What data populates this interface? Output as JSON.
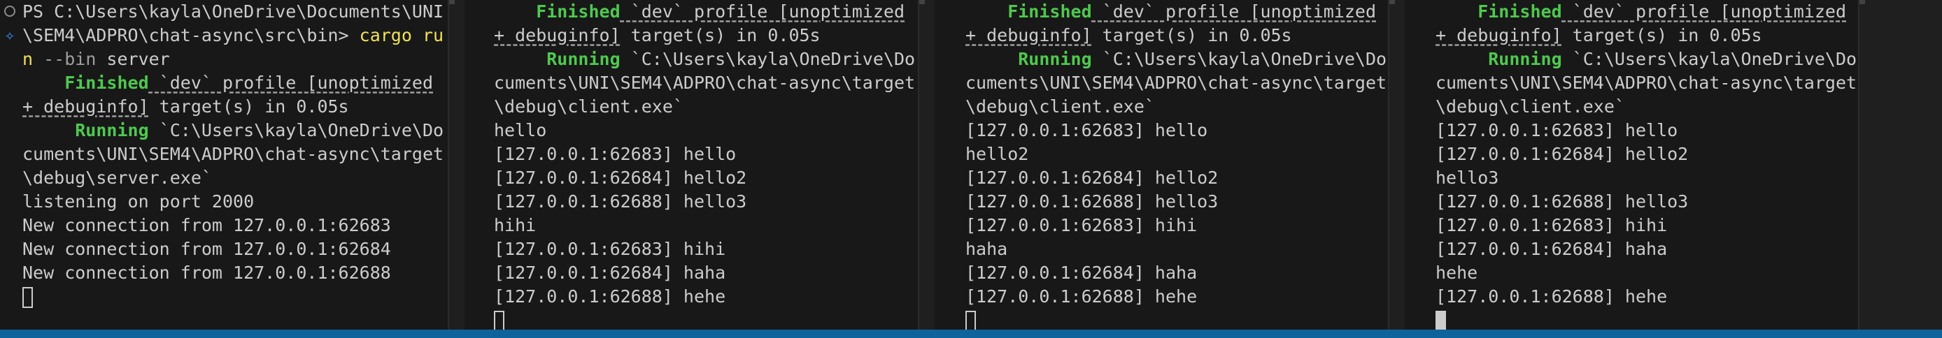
{
  "panes": [
    {
      "lines": [
        {
          "segments": [
            {
              "t": "PS C:\\Users\\kayla\\OneDrive\\Documents\\UNI",
              "c": "muted"
            }
          ]
        },
        {
          "segments": [
            {
              "t": "\\SEM4\\ADPRO\\chat-async\\src\\bin> ",
              "c": "muted"
            },
            {
              "t": "cargo ru",
              "c": "yellow"
            }
          ]
        },
        {
          "segments": [
            {
              "t": "n ",
              "c": "yellow"
            },
            {
              "t": "--bin",
              "c": "dim"
            },
            {
              "t": " server",
              "c": "muted"
            }
          ]
        },
        {
          "segments": [
            {
              "t": "    Finished",
              "c": "green"
            },
            {
              "t": " `dev` profile [unoptimized",
              "c": "ul"
            }
          ]
        },
        {
          "segments": [
            {
              "t": "+ debuginfo]",
              "c": "ul"
            },
            {
              "t": " target(s) in 0.05s",
              "c": "muted"
            }
          ]
        },
        {
          "segments": [
            {
              "t": "     Running",
              "c": "green"
            },
            {
              "t": " `C:\\Users\\kayla\\OneDrive\\Do",
              "c": "muted"
            }
          ]
        },
        {
          "segments": [
            {
              "t": "cuments\\UNI\\SEM4\\ADPRO\\chat-async\\target",
              "c": "muted"
            }
          ]
        },
        {
          "segments": [
            {
              "t": "\\debug\\server.exe`",
              "c": "muted"
            }
          ]
        },
        {
          "segments": [
            {
              "t": "listening on port 2000",
              "c": "muted"
            }
          ]
        },
        {
          "segments": [
            {
              "t": "New connection from 127.0.0.1:62683",
              "c": "muted"
            }
          ]
        },
        {
          "segments": [
            {
              "t": "New connection from 127.0.0.1:62684",
              "c": "muted"
            }
          ]
        },
        {
          "segments": [
            {
              "t": "New connection from 127.0.0.1:62688",
              "c": "muted"
            }
          ]
        }
      ],
      "cursor": "outline"
    },
    {
      "lines": [
        {
          "segments": [
            {
              "t": "    Finished",
              "c": "green"
            },
            {
              "t": " `dev` profile [unoptimized",
              "c": "ul"
            }
          ]
        },
        {
          "segments": [
            {
              "t": "+ debuginfo]",
              "c": "ul"
            },
            {
              "t": " target(s) in 0.05s",
              "c": "muted"
            }
          ]
        },
        {
          "segments": [
            {
              "t": "     Running",
              "c": "green"
            },
            {
              "t": " `C:\\Users\\kayla\\OneDrive\\Do",
              "c": "muted"
            }
          ]
        },
        {
          "segments": [
            {
              "t": "cuments\\UNI\\SEM4\\ADPRO\\chat-async\\target",
              "c": "muted"
            }
          ]
        },
        {
          "segments": [
            {
              "t": "\\debug\\client.exe`",
              "c": "muted"
            }
          ]
        },
        {
          "segments": [
            {
              "t": "hello",
              "c": "muted"
            }
          ]
        },
        {
          "segments": [
            {
              "t": "[127.0.0.1:62683] hello",
              "c": "muted"
            }
          ]
        },
        {
          "segments": [
            {
              "t": "[127.0.0.1:62684] hello2",
              "c": "muted"
            }
          ]
        },
        {
          "segments": [
            {
              "t": "[127.0.0.1:62688] hello3",
              "c": "muted"
            }
          ]
        },
        {
          "segments": [
            {
              "t": "hihi",
              "c": "muted"
            }
          ]
        },
        {
          "segments": [
            {
              "t": "[127.0.0.1:62683] hihi",
              "c": "muted"
            }
          ]
        },
        {
          "segments": [
            {
              "t": "[127.0.0.1:62684] haha",
              "c": "muted"
            }
          ]
        },
        {
          "segments": [
            {
              "t": "[127.0.0.1:62688] hehe",
              "c": "muted"
            }
          ]
        }
      ],
      "cursor": "outline"
    },
    {
      "lines": [
        {
          "segments": [
            {
              "t": "    Finished",
              "c": "green"
            },
            {
              "t": " `dev` profile [unoptimized",
              "c": "ul"
            }
          ]
        },
        {
          "segments": [
            {
              "t": "+ debuginfo]",
              "c": "ul"
            },
            {
              "t": " target(s) in 0.05s",
              "c": "muted"
            }
          ]
        },
        {
          "segments": [
            {
              "t": "     Running",
              "c": "green"
            },
            {
              "t": " `C:\\Users\\kayla\\OneDrive\\Do",
              "c": "muted"
            }
          ]
        },
        {
          "segments": [
            {
              "t": "cuments\\UNI\\SEM4\\ADPRO\\chat-async\\target",
              "c": "muted"
            }
          ]
        },
        {
          "segments": [
            {
              "t": "\\debug\\client.exe`",
              "c": "muted"
            }
          ]
        },
        {
          "segments": [
            {
              "t": "[127.0.0.1:62683] hello",
              "c": "muted"
            }
          ]
        },
        {
          "segments": [
            {
              "t": "hello2",
              "c": "muted"
            }
          ]
        },
        {
          "segments": [
            {
              "t": "[127.0.0.1:62684] hello2",
              "c": "muted"
            }
          ]
        },
        {
          "segments": [
            {
              "t": "[127.0.0.1:62688] hello3",
              "c": "muted"
            }
          ]
        },
        {
          "segments": [
            {
              "t": "[127.0.0.1:62683] hihi",
              "c": "muted"
            }
          ]
        },
        {
          "segments": [
            {
              "t": "haha",
              "c": "muted"
            }
          ]
        },
        {
          "segments": [
            {
              "t": "[127.0.0.1:62684] haha",
              "c": "muted"
            }
          ]
        },
        {
          "segments": [
            {
              "t": "[127.0.0.1:62688] hehe",
              "c": "muted"
            }
          ]
        }
      ],
      "cursor": "outline"
    },
    {
      "lines": [
        {
          "segments": [
            {
              "t": "    Finished",
              "c": "green"
            },
            {
              "t": " `dev` profile [unoptimized",
              "c": "ul"
            }
          ]
        },
        {
          "segments": [
            {
              "t": "+ debuginfo]",
              "c": "ul"
            },
            {
              "t": " target(s) in 0.05s",
              "c": "muted"
            }
          ]
        },
        {
          "segments": [
            {
              "t": "     Running",
              "c": "green"
            },
            {
              "t": " `C:\\Users\\kayla\\OneDrive\\Do",
              "c": "muted"
            }
          ]
        },
        {
          "segments": [
            {
              "t": "cuments\\UNI\\SEM4\\ADPRO\\chat-async\\target",
              "c": "muted"
            }
          ]
        },
        {
          "segments": [
            {
              "t": "\\debug\\client.exe`",
              "c": "muted"
            }
          ]
        },
        {
          "segments": [
            {
              "t": "[127.0.0.1:62683] hello",
              "c": "muted"
            }
          ]
        },
        {
          "segments": [
            {
              "t": "[127.0.0.1:62684] hello2",
              "c": "muted"
            }
          ]
        },
        {
          "segments": [
            {
              "t": "hello3",
              "c": "muted"
            }
          ]
        },
        {
          "segments": [
            {
              "t": "[127.0.0.1:62688] hello3",
              "c": "muted"
            }
          ]
        },
        {
          "segments": [
            {
              "t": "[127.0.0.1:62683] hihi",
              "c": "muted"
            }
          ]
        },
        {
          "segments": [
            {
              "t": "[127.0.0.1:62684] haha",
              "c": "muted"
            }
          ]
        },
        {
          "segments": [
            {
              "t": "hehe",
              "c": "muted"
            }
          ]
        },
        {
          "segments": [
            {
              "t": "[127.0.0.1:62688] hehe",
              "c": "muted"
            }
          ]
        }
      ],
      "cursor": "filled"
    }
  ],
  "icons": {
    "pane0_status": "circle-icon",
    "pane0_suggest": "sparkle-icon"
  },
  "colors": {
    "background": "#181818",
    "finished_running": "#4ec94e",
    "command": "#f1e05a",
    "text": "#cccccc",
    "status_bar": "#0e639c"
  }
}
